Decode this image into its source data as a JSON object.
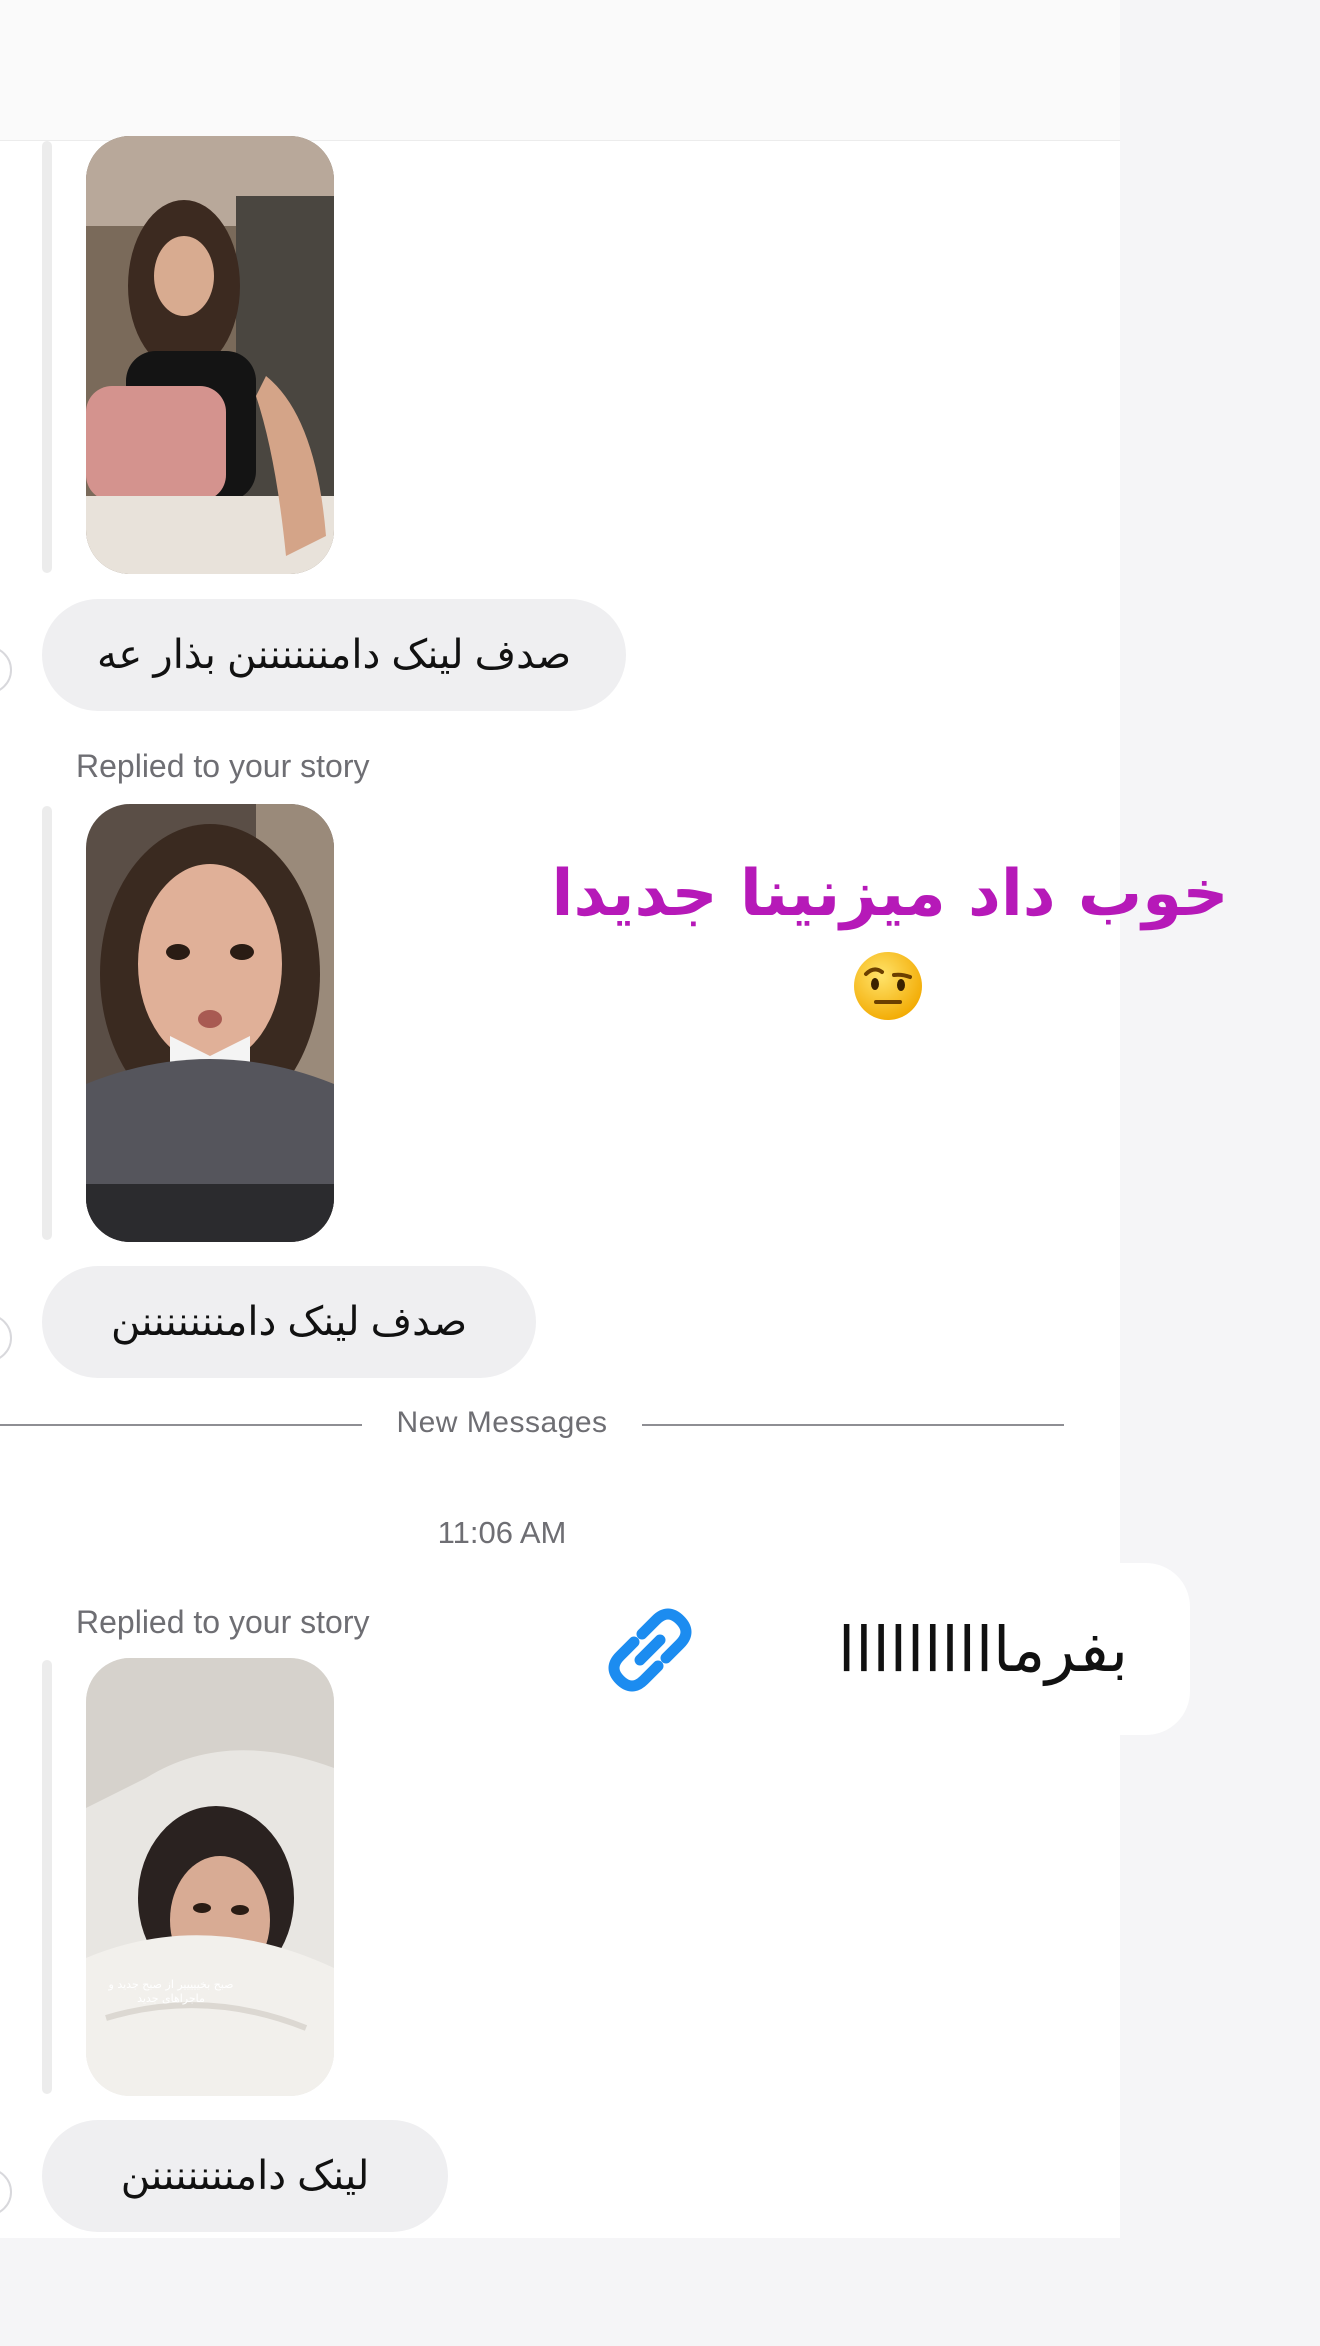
{
  "header": {
    "title": ""
  },
  "messages": [
    {
      "type": "story_reply",
      "label": "",
      "text": "صدف لینک دامننننننن بذار عه"
    },
    {
      "type": "story_reply",
      "label": "Replied to your story",
      "text": "صدف لینک دامنننننننن"
    },
    {
      "type": "story_reply",
      "label": "Replied to your story",
      "text": "لینک دامنننننننن",
      "story_caption": "صبح بخیییییر از صبح جدید و ماجراهای جدید"
    }
  ],
  "divider": {
    "label": "New Messages"
  },
  "timestamp": "11:06 AM",
  "overlay": {
    "sticker_text": "خوب داد میزنینا جدیدا",
    "sticker_emoji": "face-with-raised-eyebrow",
    "link_text": "بفرماااااااااا",
    "link_icon": "link-icon"
  },
  "colors": {
    "sticker": "#b619b8",
    "link_icon": "#1c8cf0",
    "bubble": "#efeff1",
    "muted_text": "#6e6e73"
  }
}
